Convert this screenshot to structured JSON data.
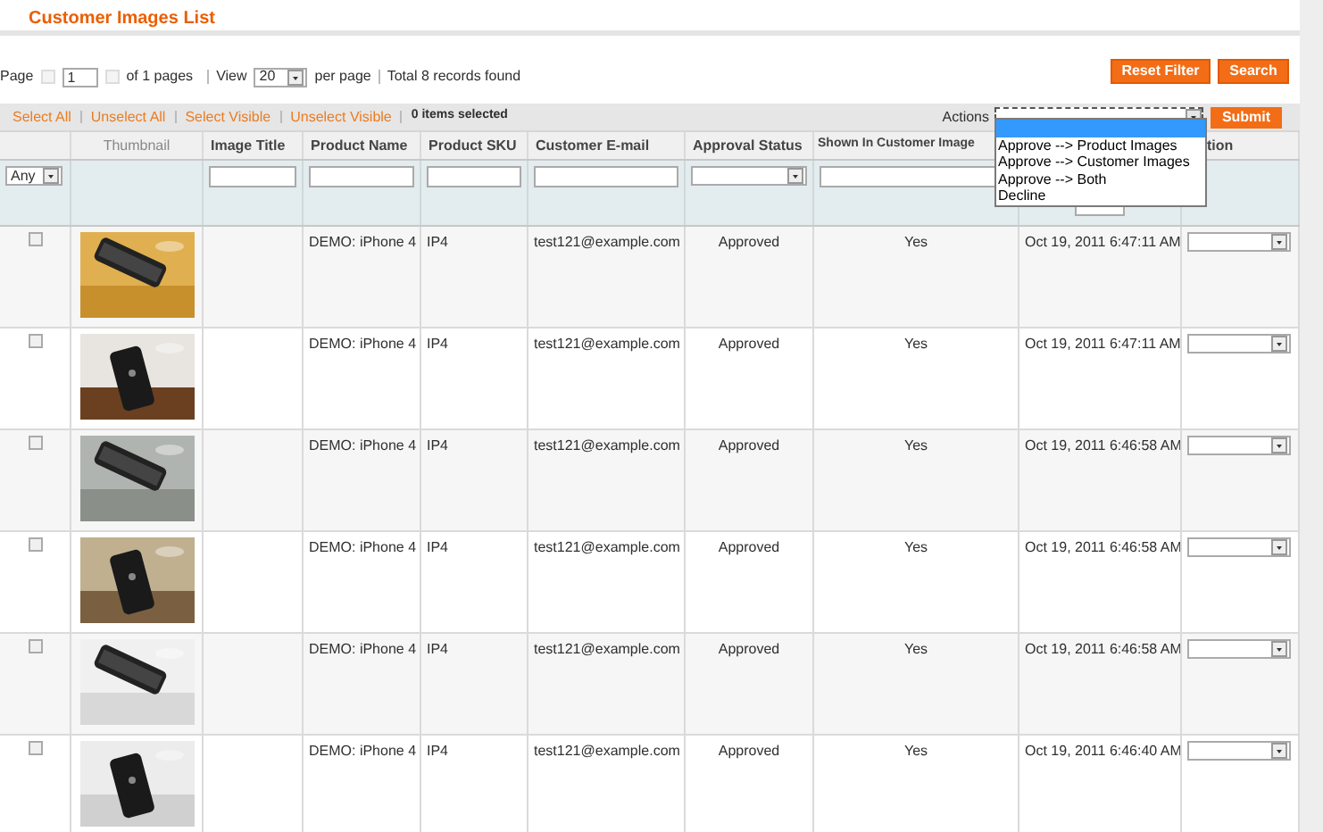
{
  "title": "Customer Images List",
  "pager": {
    "page_label": "Page",
    "page": "1",
    "of_pages": "of 1 pages",
    "view_label": "View",
    "per_page": "20",
    "per_page_label": "per page",
    "total": "Total 8 records found"
  },
  "buttons": [
    "Reset Filter",
    "Search"
  ],
  "massaction": {
    "links": [
      "Select All",
      "Unselect All",
      "Select Visible",
      "Unselect Visible"
    ],
    "count": "0 items selected",
    "actions_label": "Actions",
    "submit": "Submit",
    "dropdown_options": [
      {
        "selected": true
      },
      {
        "label": "Approve --> Product Images",
        "selected": false
      },
      {
        "label": "Approve --> Customer Images",
        "selected": false
      },
      {
        "label": "Approve --> Both",
        "selected": false
      },
      {
        "label": "Decline",
        "selected": false
      }
    ]
  },
  "columns": [
    "",
    "Thumbnail",
    "Image Title",
    "Product Name",
    "Product SKU",
    "Customer E-mail",
    "Approval Status",
    "Shown In Customer Image",
    "",
    "tion"
  ],
  "filter_any": "Any",
  "rows": [
    {
      "checked": false,
      "product_name": "DEMO: iPhone 4",
      "sku": "IP4",
      "email": "test121@example.com",
      "status": "Approved",
      "shown": "Yes",
      "created": "Oct 19, 2011 6:47:11 AM"
    },
    {
      "checked": false,
      "product_name": "DEMO: iPhone 4",
      "sku": "IP4",
      "email": "test121@example.com",
      "status": "Approved",
      "shown": "Yes",
      "created": "Oct 19, 2011 6:47:11 AM"
    },
    {
      "checked": false,
      "product_name": "DEMO: iPhone 4",
      "sku": "IP4",
      "email": "test121@example.com",
      "status": "Approved",
      "shown": "Yes",
      "created": "Oct 19, 2011 6:46:58 AM"
    },
    {
      "checked": false,
      "product_name": "DEMO: iPhone 4",
      "sku": "IP4",
      "email": "test121@example.com",
      "status": "Approved",
      "shown": "Yes",
      "created": "Oct 19, 2011 6:46:58 AM"
    },
    {
      "checked": false,
      "product_name": "DEMO: iPhone 4",
      "sku": "IP4",
      "email": "test121@example.com",
      "status": "Approved",
      "shown": "Yes",
      "created": "Oct 19, 2011 6:46:58 AM"
    },
    {
      "checked": false,
      "product_name": "DEMO: iPhone 4",
      "sku": "IP4",
      "email": "test121@example.com",
      "status": "Approved",
      "shown": "Yes",
      "created": "Oct 19, 2011 6:46:40 AM"
    }
  ]
}
